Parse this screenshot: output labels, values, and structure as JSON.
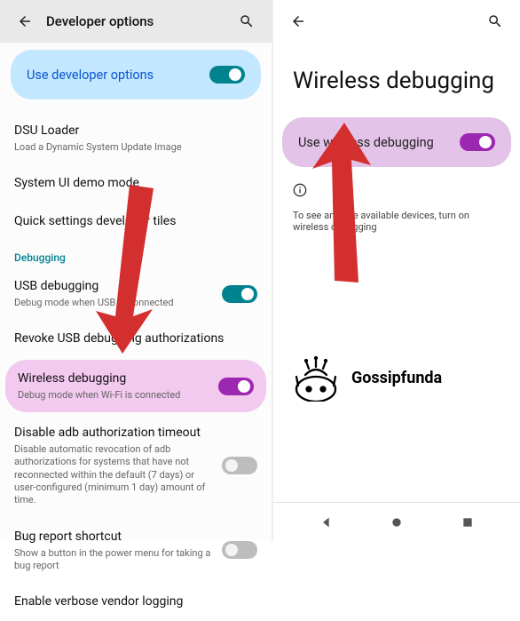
{
  "left": {
    "title": "Developer options",
    "pill_label": "Use developer options",
    "items": {
      "dsu_title": "DSU Loader",
      "dsu_sub": "Load a Dynamic System Update Image",
      "sysui_title": "System UI demo mode",
      "quicksettings_title": "Quick settings developer tiles",
      "section_debugging": "Debugging",
      "usb_title": "USB debugging",
      "usb_sub": "Debug mode when USB is connected",
      "revoke_title": "Revoke USB debugging authorizations",
      "wireless_title": "Wireless debugging",
      "wireless_sub": "Debug mode when Wi-Fi is connected",
      "adb_timeout_title": "Disable adb authorization timeout",
      "adb_timeout_sub": "Disable automatic revocation of adb authorizations for systems that have not reconnected within the default (7 days) or user-configured (minimum 1 day) amount of time.",
      "bugreport_title": "Bug report shortcut",
      "bugreport_sub": "Show a button in the power menu for taking a bug report",
      "verbose_title": "Enable verbose vendor logging"
    }
  },
  "right": {
    "big_title": "Wireless debugging",
    "pill_label": "Use wireless debugging",
    "info_text": "To see and use available devices, turn on wireless debugging",
    "logo_text": "Gossipfunda"
  }
}
